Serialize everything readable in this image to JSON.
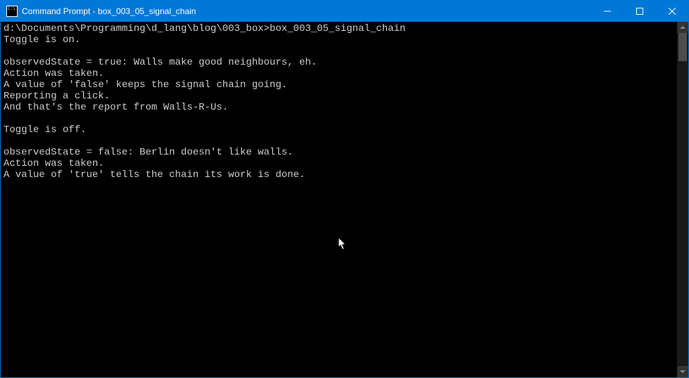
{
  "window": {
    "title": "Command Prompt - box_003_05_signal_chain"
  },
  "terminal": {
    "prompt": "d:\\Documents\\Programming\\d_lang\\blog\\003_box>",
    "command": "box_003_05_signal_chain",
    "lines": [
      "Toggle is on.",
      "",
      "observedState = true: Walls make good neighbours, eh.",
      "Action was taken.",
      "A value of 'false' keeps the signal chain going.",
      "Reporting a click.",
      "And that's the report from Walls-R-Us.",
      "",
      "Toggle is off.",
      "",
      "observedState = false: Berlin doesn't like walls.",
      "Action was taken.",
      "A value of 'true' tells the chain its work is done."
    ]
  }
}
